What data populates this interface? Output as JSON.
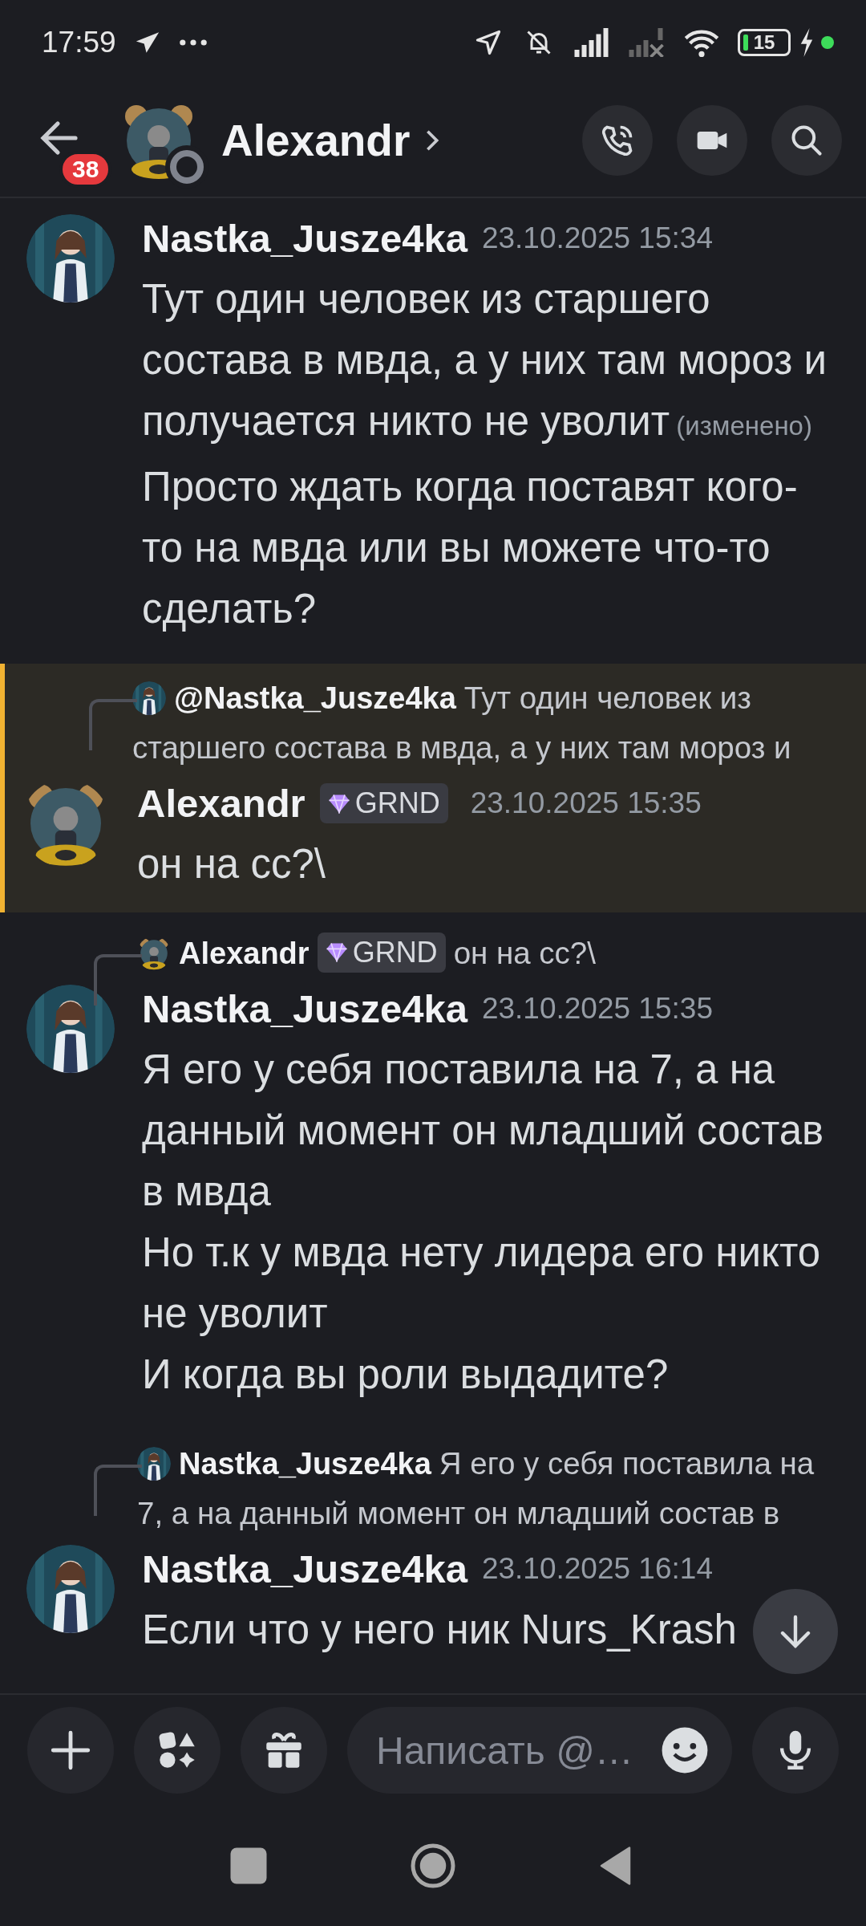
{
  "status_bar": {
    "time": "17:59",
    "battery": "15"
  },
  "header": {
    "badge": "38",
    "title": "Alexandr"
  },
  "messages": [
    {
      "highlighted": false,
      "author": "Nastka_Jusze4ka",
      "timestamp": "23.10.2025 15:34",
      "paragraphs": [
        {
          "text": "Тут один человек из старшего состава в мвда, а у них там мороз и получается никто не уволит",
          "edited": "(изменено)"
        },
        {
          "text": "Просто ждать когда поставят кого-то на мвда или вы можете что-то сделать?"
        }
      ]
    },
    {
      "highlighted": true,
      "reply": {
        "author": "@Nastka_Jusze4ka",
        "text": "Тут один человек из старшего состава в мвда, а у них там мороз и"
      },
      "author": "Alexandr",
      "tag": "GRND",
      "timestamp": "23.10.2025 15:35",
      "paragraphs": [
        {
          "text": "он на сс?\\"
        }
      ]
    },
    {
      "highlighted": false,
      "reply": {
        "author": "Alexandr",
        "tag": "GRND",
        "text": "он на сс?\\"
      },
      "author": "Nastka_Jusze4ka",
      "timestamp": "23.10.2025 15:35",
      "paragraphs": [
        {
          "text": "Я его у себя поставила на 7, а на данный момент он младший состав в мвда"
        },
        {
          "text": "Но т.к у мвда нету лидера его никто не уволит"
        },
        {
          "text": "И когда вы роли выдадите?"
        }
      ]
    },
    {
      "highlighted": false,
      "reply": {
        "author": "Nastka_Jusze4ka",
        "text": "Я его у себя поставила на 7, а на данный момент он младший состав в"
      },
      "author": "Nastka_Jusze4ka",
      "timestamp": "23.10.2025 16:14",
      "paragraphs": [
        {
          "text": "Если что у него ник Nurs_Krash"
        }
      ]
    }
  ],
  "composer": {
    "placeholder": "Написать @…"
  }
}
